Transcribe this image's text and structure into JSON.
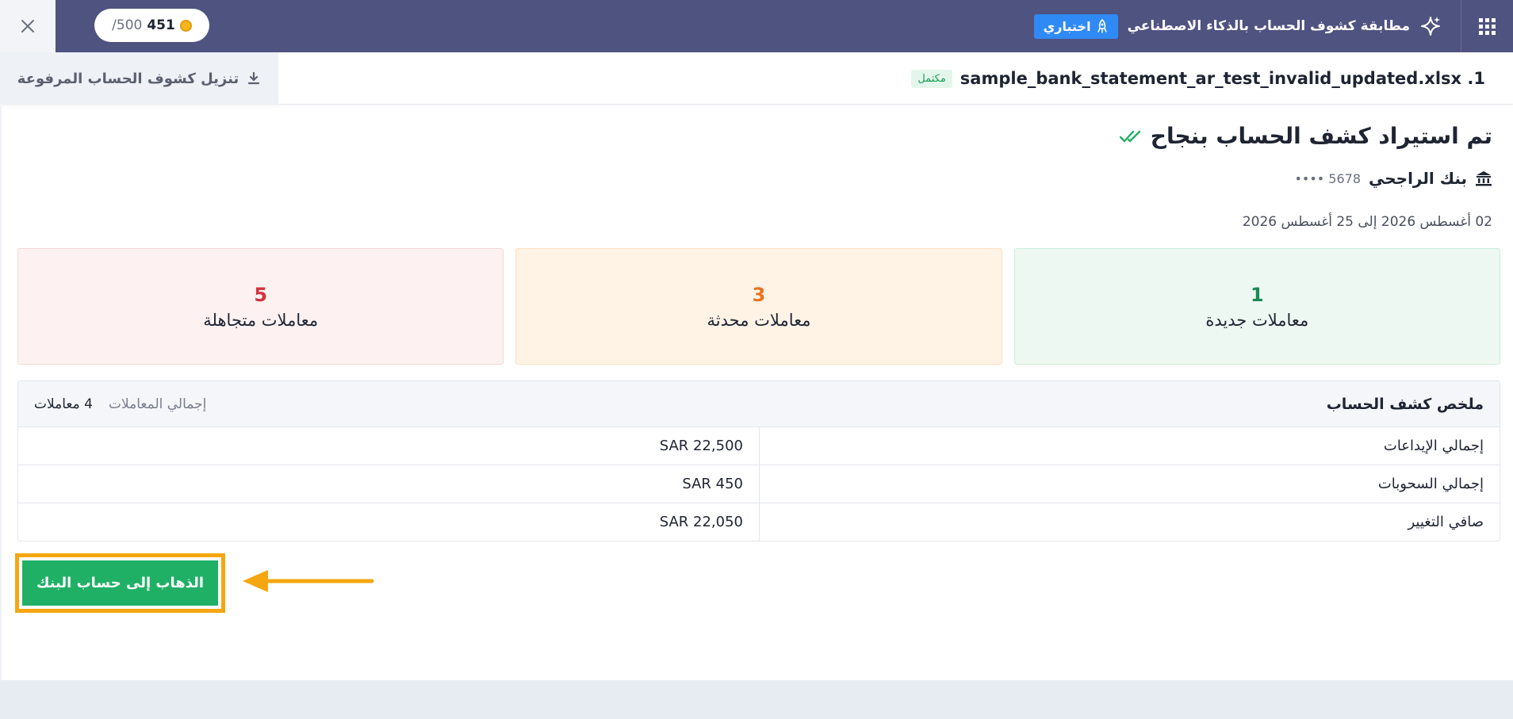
{
  "header": {
    "app_title": "مطابقة كشوف الحساب بالذكاء الاصطناعي",
    "beta_label": "اختباري",
    "credits_used": "451",
    "credits_total": "/500"
  },
  "file_row": {
    "file_name": "sample_bank_statement_ar_test_invalid_updated.xlsx .1",
    "status": "مكتمل",
    "download_label": "تنزيل كشوف الحساب المرفوعة"
  },
  "result": {
    "heading": "تم استيراد كشف الحساب بنجاح",
    "bank_name": "بنك الراجحي",
    "account_masked": "5678 ••••",
    "period": "02 أغسطس 2026 إلى 25 أغسطس 2026"
  },
  "cards": [
    {
      "count": "1",
      "label": "معاملات جديدة",
      "color": "#1a8a54"
    },
    {
      "count": "3",
      "label": "معاملات محدثة",
      "color": "#e9731f"
    },
    {
      "count": "5",
      "label": "معاملات متجاهلة",
      "color": "#d1343c"
    }
  ],
  "summary": {
    "title": "ملخص كشف الحساب",
    "total_label": "إجمالي المعاملات",
    "total_value": "4 معاملات",
    "rows": [
      {
        "label": "إجمالي الإيداعات",
        "value": "SAR 22,500"
      },
      {
        "label": "إجمالي السحوبات",
        "value": "SAR 450"
      },
      {
        "label": "صافي التغيير",
        "value": "SAR 22,050"
      }
    ]
  },
  "actions": {
    "go_to_bank_label": "الذهاب إلى حساب البنك"
  },
  "icons": {
    "close": "close-icon",
    "apps": "grid-icon",
    "sparkle": "sparkle-icon",
    "rocket": "rocket-icon",
    "download": "download-icon",
    "check": "double-check-icon",
    "bank": "bank-icon",
    "coin": "coin-icon",
    "arrow": "arrow-left-icon"
  },
  "colors": {
    "topbar": "#4f5380",
    "beta": "#2f8af5",
    "primary_button": "#1fb066",
    "highlight": "#f5a70f"
  }
}
